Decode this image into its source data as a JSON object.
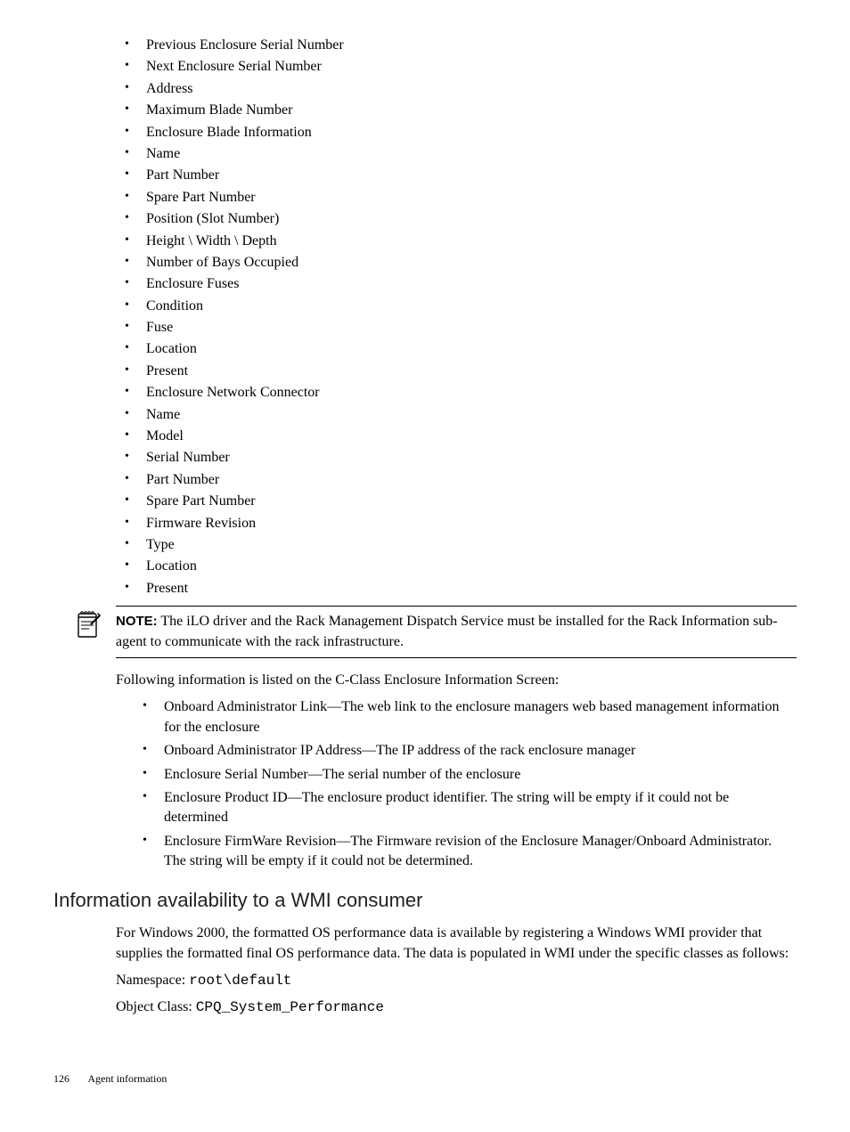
{
  "list1": [
    "Previous Enclosure Serial Number",
    "Next Enclosure Serial Number",
    "Address",
    "Maximum Blade Number",
    "Enclosure Blade Information",
    "Name",
    "Part Number",
    "Spare Part Number",
    "Position (Slot Number)",
    "Height \\ Width \\ Depth",
    "Number of Bays Occupied",
    "Enclosure Fuses",
    "Condition",
    "Fuse",
    "Location",
    "Present",
    "Enclosure Network Connector",
    "Name",
    "Model",
    "Serial Number",
    "Part Number",
    "Spare Part Number",
    "Firmware Revision",
    "Type",
    "Location",
    "Present"
  ],
  "note": {
    "label": "NOTE:",
    "text": "The iLO driver and the Rack Management Dispatch Service must be installed for the Rack Information sub-agent to communicate with the rack infrastructure."
  },
  "para_after_note": "Following information is listed on the C-Class Enclosure Information Screen:",
  "list2": [
    "Onboard Administrator Link—The web link to the enclosure managers web based management information for the enclosure",
    "Onboard Administrator IP Address—The IP address of the rack enclosure manager",
    "Enclosure Serial Number—The serial number of the enclosure",
    "Enclosure Product ID—The enclosure product identifier. The string will be empty if it could not be determined",
    "Enclosure FirmWare Revision—The Firmware revision of the Enclosure Manager/Onboard Administrator. The string will be empty if it could not be determined."
  ],
  "section_heading": "Information availability to a WMI consumer",
  "para_section": "For Windows 2000, the formatted OS performance data is available by registering a Windows WMI provider that supplies the formatted final OS performance data. The data is populated in WMI under the specific classes as follows:",
  "namespace_label": "Namespace: ",
  "namespace_value": "root\\default",
  "objclass_label": "Object Class: ",
  "objclass_value": "CPQ_System_Performance",
  "footer": {
    "page": "126",
    "title": "Agent information"
  }
}
